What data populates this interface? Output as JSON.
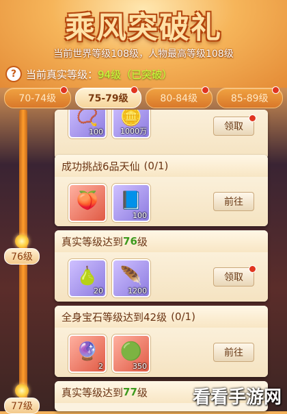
{
  "header": {
    "title": "乘风突破礼",
    "subtitle": "当前世界等级108级，人物最高等级108级",
    "real_level_label": "当前真实等级：",
    "real_level_value": "94级（已突破）"
  },
  "tabs": [
    {
      "label": "70-74级",
      "active": false,
      "badge": true
    },
    {
      "label": "75-79级",
      "active": true,
      "badge": true
    },
    {
      "label": "80-84级",
      "active": false,
      "badge": true
    },
    {
      "label": "85-89级",
      "active": false,
      "badge": true
    }
  ],
  "track": {
    "tags": [
      "76级",
      "77级"
    ]
  },
  "cards": [
    {
      "title_pre": "",
      "title_hl": "",
      "title_post": "",
      "progress": "",
      "items": [
        {
          "glyph": "📿",
          "count": "100",
          "color": "purple"
        },
        {
          "glyph": "🪙",
          "count": "1000万",
          "color": "purple"
        }
      ],
      "button": "领取",
      "button_badge": true
    },
    {
      "title_pre": "成功挑战6品天仙",
      "title_hl": "",
      "title_post": "",
      "progress": "(0/1)",
      "items": [
        {
          "glyph": "🍑",
          "count": "",
          "color": "red"
        },
        {
          "glyph": "📘",
          "count": "100",
          "color": "purple"
        }
      ],
      "button": "前往",
      "button_badge": false
    },
    {
      "title_pre": "真实等级达到",
      "title_hl": "76",
      "title_post": "级",
      "progress": "",
      "items": [
        {
          "glyph": "🍐",
          "count": "20",
          "color": "purple"
        },
        {
          "glyph": "🪶",
          "count": "1200",
          "color": "purple"
        }
      ],
      "button": "领取",
      "button_badge": true
    },
    {
      "title_pre": "全身宝石等级达到42级",
      "title_hl": "",
      "title_post": "",
      "progress": "(0/1)",
      "items": [
        {
          "glyph": "🔮",
          "count": "2",
          "color": "red"
        },
        {
          "glyph": "🟢",
          "count": "350",
          "color": "red"
        }
      ],
      "button": "前往",
      "button_badge": false
    },
    {
      "title_pre": "真实等级达到",
      "title_hl": "77",
      "title_post": "级",
      "progress": ""
    }
  ],
  "watermark": "看看手游网"
}
